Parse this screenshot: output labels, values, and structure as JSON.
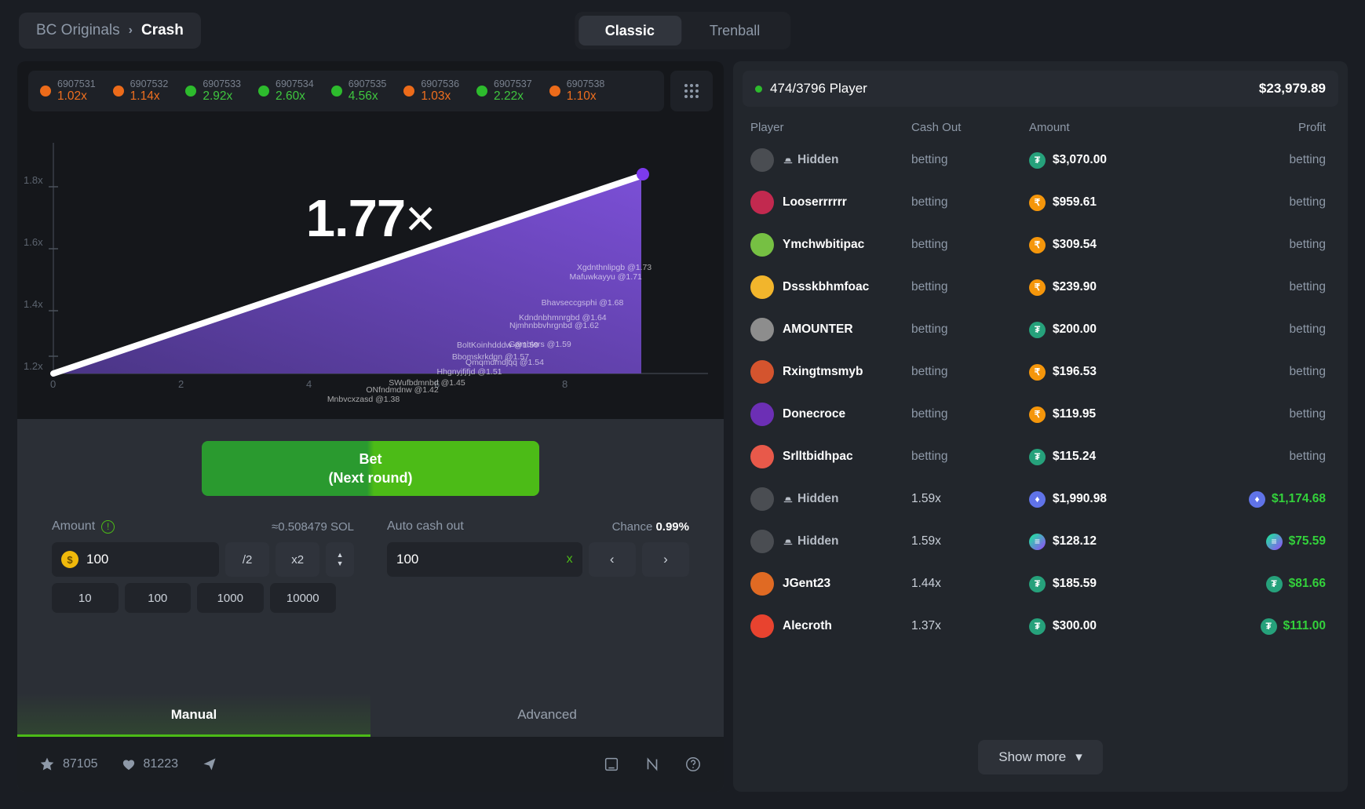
{
  "breadcrumb": {
    "root": "BC Originals",
    "separator": "›",
    "current": "Crash"
  },
  "mode_tabs": {
    "classic": "Classic",
    "trenball": "Trenball"
  },
  "history": [
    {
      "id": "6907531",
      "multiplier": "1.02x",
      "color": "orange"
    },
    {
      "id": "6907532",
      "multiplier": "1.14x",
      "color": "orange"
    },
    {
      "id": "6907533",
      "multiplier": "2.92x",
      "color": "green"
    },
    {
      "id": "6907534",
      "multiplier": "2.60x",
      "color": "green"
    },
    {
      "id": "6907535",
      "multiplier": "4.56x",
      "color": "green"
    },
    {
      "id": "6907536",
      "multiplier": "1.03x",
      "color": "orange"
    },
    {
      "id": "6907537",
      "multiplier": "2.22x",
      "color": "green"
    },
    {
      "id": "6907538",
      "multiplier": "1.10x",
      "color": "orange"
    }
  ],
  "chart_data": {
    "type": "line",
    "title": "",
    "current_multiplier": "1.77",
    "multiplier_suffix": "×",
    "xlabel": "",
    "ylabel": "",
    "x_ticks": [
      "0",
      "2",
      "4",
      "6",
      "8"
    ],
    "y_ticks": [
      "1.2x",
      "1.4x",
      "1.6x",
      "1.8x"
    ],
    "xlim": [
      0,
      9.2
    ],
    "ylim": [
      1.0,
      1.95
    ],
    "grid": false,
    "legend": "none",
    "curve_color": "#ffffff",
    "fill_color": "#5b3fa8",
    "head_point_color": "#7c3aed",
    "x": [
      0,
      1,
      2,
      3,
      4,
      5,
      6,
      7,
      8,
      8.8
    ],
    "y": [
      1.0,
      1.09,
      1.18,
      1.27,
      1.36,
      1.45,
      1.54,
      1.63,
      1.72,
      1.77
    ],
    "cashout_labels": [
      {
        "text": "Xgdnthnlipgb @1.73",
        "x": 0.845,
        "y": 0.135
      },
      {
        "text": "Mafuwkayyu @1.71",
        "x": 0.833,
        "y": 0.165
      },
      {
        "text": "Bhavseccgsphi @1.68",
        "x": 0.8,
        "y": 0.252
      },
      {
        "text": "Kdndnbhmnrgbd @1.64",
        "x": 0.772,
        "y": 0.302
      },
      {
        "text": "Njmhnbbvhrgnbd @1.62",
        "x": 0.76,
        "y": 0.33
      },
      {
        "text": "Gamblers @1.59",
        "x": 0.74,
        "y": 0.392
      },
      {
        "text": "BoltKoinhdddw @1.59",
        "x": 0.68,
        "y": 0.396
      },
      {
        "text": "Bbomskrkdgn @1.57",
        "x": 0.67,
        "y": 0.435
      },
      {
        "text": "Qmqmdmdjqq @1.54",
        "x": 0.69,
        "y": 0.452
      },
      {
        "text": "Hhgnyjfjfjd @1.51",
        "x": 0.64,
        "y": 0.485
      },
      {
        "text": "SWufbdmnbd @1.45",
        "x": 0.58,
        "y": 0.52
      },
      {
        "text": "ONfndmdnw @1.42",
        "x": 0.545,
        "y": 0.545
      },
      {
        "text": "Mnbvcxzasd @1.38",
        "x": 0.49,
        "y": 0.575
      }
    ]
  },
  "bet": {
    "label": "Bet",
    "sublabel": "(Next round)"
  },
  "amount_field": {
    "label": "Amount",
    "equivalent": "≈0.508479 SOL",
    "value": "100",
    "half_label": "/2",
    "double_label": "x2",
    "quick": [
      "10",
      "100",
      "1000",
      "10000"
    ]
  },
  "autocash_field": {
    "label": "Auto cash out",
    "chance_label": "Chance",
    "chance_value": "0.99%",
    "value": "100",
    "suffix": "x"
  },
  "bet_mode_tabs": {
    "manual": "Manual",
    "advanced": "Advanced"
  },
  "footer": {
    "stars": "87105",
    "likes": "81223"
  },
  "players_panel": {
    "status": "474/3796 Player",
    "total": "$23,979.89",
    "columns": {
      "player": "Player",
      "cashout": "Cash Out",
      "amount": "Amount",
      "profit": "Profit"
    },
    "show_more": "Show more",
    "rows": [
      {
        "name": "Hidden",
        "hidden": true,
        "avatar": "#4a4d52",
        "cashout": "betting",
        "currency": "usdt",
        "currency_symbol": "₮",
        "amount": "$3,070.00",
        "profit": "betting",
        "profit_win": false
      },
      {
        "name": "Looserrrrrr",
        "hidden": false,
        "avatar": "#c2294f",
        "cashout": "betting",
        "currency": "inr",
        "currency_symbol": "₹",
        "amount": "$959.61",
        "profit": "betting",
        "profit_win": false
      },
      {
        "name": "Ymchwbitipac",
        "hidden": false,
        "avatar": "#76c043",
        "cashout": "betting",
        "currency": "inr",
        "currency_symbol": "₹",
        "amount": "$309.54",
        "profit": "betting",
        "profit_win": false
      },
      {
        "name": "Dssskbhmfoac",
        "hidden": false,
        "avatar": "#f2b52c",
        "cashout": "betting",
        "currency": "inr",
        "currency_symbol": "₹",
        "amount": "$239.90",
        "profit": "betting",
        "profit_win": false
      },
      {
        "name": "AMOUNTER",
        "hidden": false,
        "avatar": "#8d8d8d",
        "cashout": "betting",
        "currency": "usdt",
        "currency_symbol": "₮",
        "amount": "$200.00",
        "profit": "betting",
        "profit_win": false
      },
      {
        "name": "Rxingtmsmyb",
        "hidden": false,
        "avatar": "#d4542e",
        "cashout": "betting",
        "currency": "inr",
        "currency_symbol": "₹",
        "amount": "$196.53",
        "profit": "betting",
        "profit_win": false
      },
      {
        "name": "Donecroce",
        "hidden": false,
        "avatar": "#6c2fb5",
        "cashout": "betting",
        "currency": "inr",
        "currency_symbol": "₹",
        "amount": "$119.95",
        "profit": "betting",
        "profit_win": false
      },
      {
        "name": "Srlltbidhpac",
        "hidden": false,
        "avatar": "#e8594a",
        "cashout": "betting",
        "currency": "usdt",
        "currency_symbol": "₮",
        "amount": "$115.24",
        "profit": "betting",
        "profit_win": false
      },
      {
        "name": "Hidden",
        "hidden": true,
        "avatar": "#4a4d52",
        "cashout": "1.59x",
        "currency": "eth",
        "currency_symbol": "♦",
        "amount": "$1,990.98",
        "profit": "$1,174.68",
        "profit_win": true,
        "profit_currency": "eth",
        "profit_symbol": "♦"
      },
      {
        "name": "Hidden",
        "hidden": true,
        "avatar": "#4a4d52",
        "cashout": "1.59x",
        "currency": "sol",
        "currency_symbol": "≡",
        "amount": "$128.12",
        "profit": "$75.59",
        "profit_win": true,
        "profit_currency": "sol",
        "profit_symbol": "≡"
      },
      {
        "name": "JGent23",
        "hidden": false,
        "avatar": "#e06a23",
        "cashout": "1.44x",
        "currency": "usdt",
        "currency_symbol": "₮",
        "amount": "$185.59",
        "profit": "$81.66",
        "profit_win": true,
        "profit_currency": "usdt",
        "profit_symbol": "₮"
      },
      {
        "name": "Alecroth",
        "hidden": false,
        "avatar": "#e8432f",
        "cashout": "1.37x",
        "currency": "usdt",
        "currency_symbol": "₮",
        "amount": "$300.00",
        "profit": "$111.00",
        "profit_win": true,
        "profit_currency": "usdt",
        "profit_symbol": "₮"
      }
    ]
  }
}
